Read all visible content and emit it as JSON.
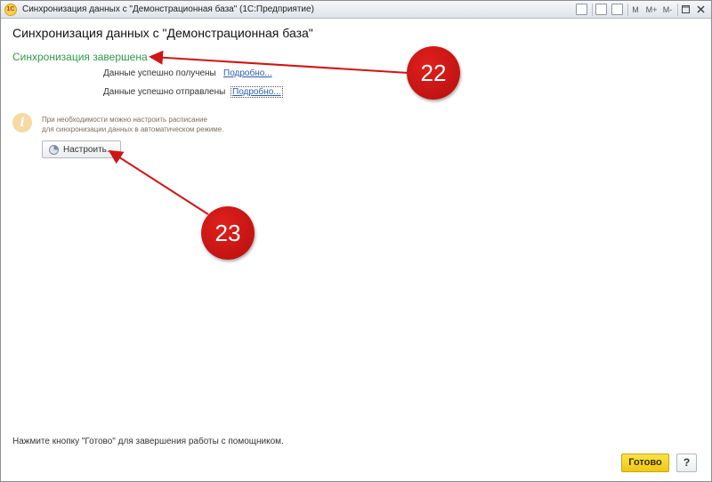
{
  "window": {
    "title": "Синхронизация данных с \"Демонстрационная база\"  (1С:Предприятие)",
    "app_icon": "1C",
    "toolbar": {
      "memory_m": "M",
      "memory_m_plus": "M+",
      "memory_m_minus": "M-"
    }
  },
  "form": {
    "heading": "Синхронизация данных с \"Демонстрационная база\"",
    "status": "Синхронизация завершена",
    "received": {
      "label": "Данные успешно получены",
      "link": "Подробно..."
    },
    "sent": {
      "label": "Данные успешно отправлены",
      "link": "Подробно..."
    },
    "info_line1": "При необходимости можно настроить расписание",
    "info_line2": "для синхронизации данных в автоматическом режиме.",
    "setup_button": "Настроить...",
    "footer": "Нажмите кнопку \"Готово\" для завершения работы с помощником.",
    "done_button": "Готово",
    "help_button": "?"
  },
  "annotations": {
    "callout_22": "22",
    "callout_23": "23",
    "color": "#d01515"
  },
  "colors": {
    "status_green": "#2e9a4a",
    "link_blue": "#2a5fa8",
    "done_yellow": "#f5d42a"
  }
}
